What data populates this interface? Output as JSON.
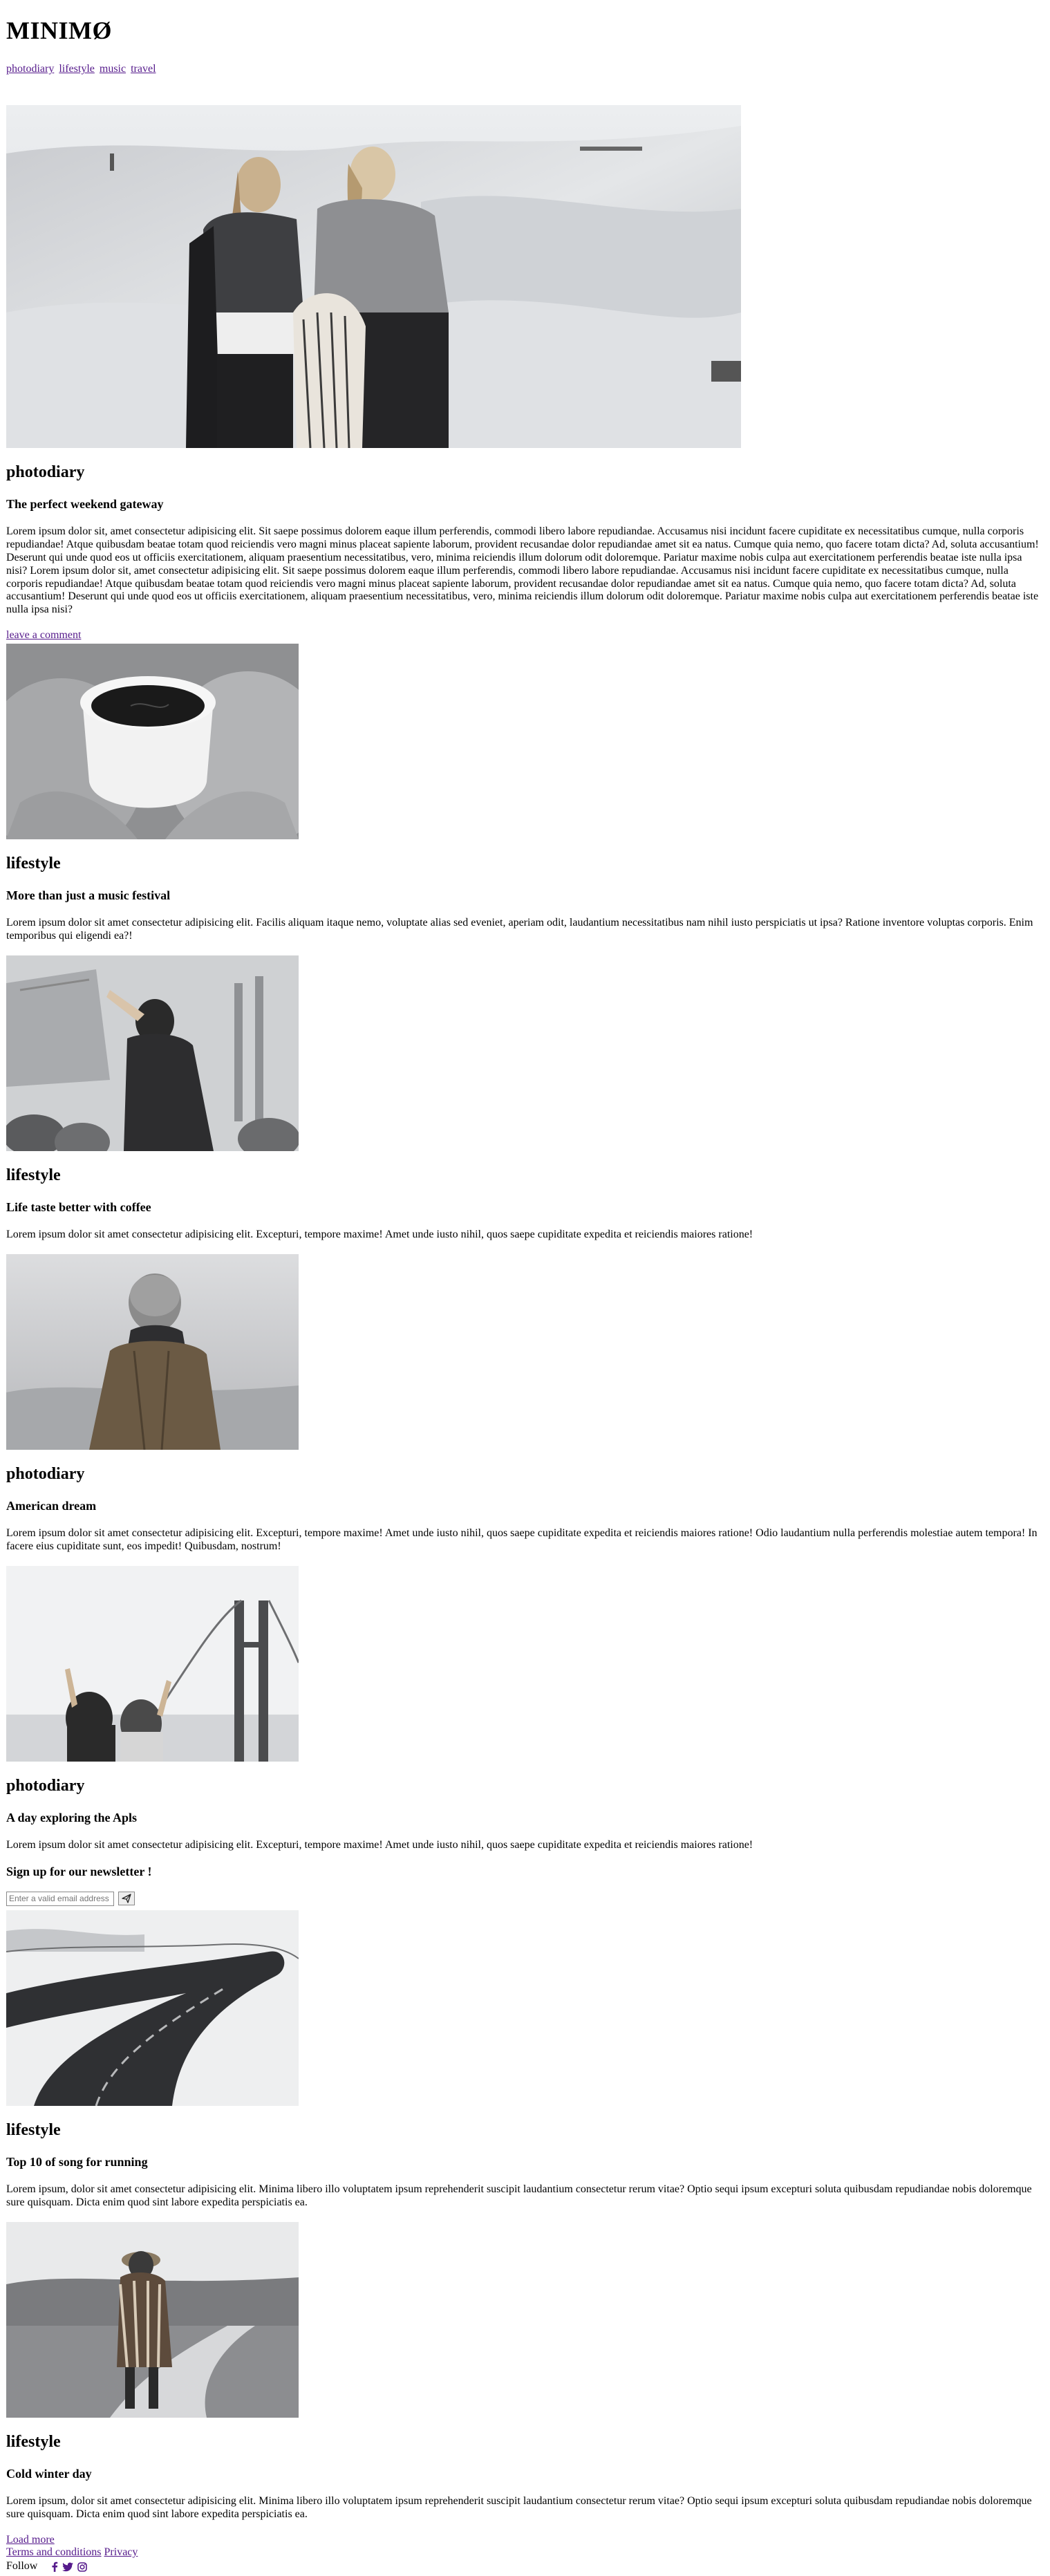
{
  "brand": "MINIMØ",
  "nav": [
    "photodiary",
    "lifestyle",
    "music",
    "travel"
  ],
  "hero": {
    "image_alt": "two women in winter clothing on snowy hill",
    "category": "photodiary",
    "title": "The perfect weekend gateway",
    "excerpt": "Lorem ipsum dolor sit, amet consectetur adipisicing elit. Sit saepe possimus dolorem eaque illum perferendis, commodi libero labore repudiandae. Accusamus nisi incidunt facere cupiditate ex necessitatibus cumque, nulla corporis repudiandae! Atque quibusdam beatae totam quod reiciendis vero magni minus placeat sapiente laborum, provident recusandae dolor repudiandae amet sit ea natus. Cumque quia nemo, quo facere totam dicta? Ad, soluta accusantium! Deserunt qui unde quod eos ut officiis exercitationem, aliquam praesentium necessitatibus, vero, minima reiciendis illum dolorum odit doloremque. Pariatur maxime nobis culpa aut exercitationem perferendis beatae iste nulla ipsa nisi? Lorem ipsum dolor sit, amet consectetur adipisicing elit. Sit saepe possimus dolorem eaque illum perferendis, commodi libero labore repudiandae. Accusamus nisi incidunt facere cupiditate ex necessitatibus cumque, nulla corporis repudiandae! Atque quibusdam beatae totam quod reiciendis vero magni minus placeat sapiente laborum, provident recusandae dolor repudiandae amet sit ea natus. Cumque quia nemo, quo facere totam dicta? Ad, soluta accusantium! Deserunt qui unde quod eos ut officiis exercitationem, aliquam praesentium necessitatibus, vero, minima reiciendis illum dolorum odit doloremque. Pariatur maxime nobis culpa aut exercitationem perferendis beatae iste nulla ipsa nisi?",
    "comment_link": "leave a comment"
  },
  "posts": [
    {
      "image_alt": "hands in knit mittens holding coffee cup",
      "category": "lifestyle",
      "title": "More than just a music festival",
      "excerpt": "Lorem ipsum dolor sit amet consectetur adipisicing elit. Facilis aliquam itaque nemo, voluptate alias sed eveniet, aperiam odit, laudantium necessitatibus nam nihil iusto perspiciatis ut ipsa? Ratione inventore voluptas corporis. Enim temporibus qui eligendi ea?!"
    },
    {
      "image_alt": "woman dancing at outdoor music festival",
      "category": "lifestyle",
      "title": "Life taste better with coffee",
      "excerpt": "Lorem ipsum dolor sit amet consectetur adipisicing elit. Excepturi, tempore maxime! Amet unde iusto nihil, quos saepe cupiditate expedita et reiciendis maiores ratione!"
    },
    {
      "image_alt": "person in beanie and jacket seen from behind",
      "category": "photodiary",
      "title": "American dream",
      "excerpt": "Lorem ipsum dolor sit amet consectetur adipisicing elit. Excepturi, tempore maxime! Amet unde iusto nihil, quos saepe cupiditate expedita et reiciendis maiores ratione! Odio laudantium nulla perferendis molestiae autem tempora! In facere eius cupiditate sunt, eos impedit! Quibusdam, nostrum!"
    },
    {
      "image_alt": "two friends with peace signs near bridge",
      "category": "photodiary",
      "title": "A day exploring the Apls",
      "excerpt": "Lorem ipsum dolor sit amet consectetur adipisicing elit. Excepturi, tempore maxime! Amet unde iusto nihil, quos saepe cupiditate expedita et reiciendis maiores ratione!"
    }
  ],
  "newsletter": {
    "title": "Sign up for our newsletter !",
    "placeholder": "Enter a valid email address"
  },
  "posts2": [
    {
      "image_alt": "winding road through snowy landscape",
      "category": "lifestyle",
      "title": "Top 10 of song for running",
      "excerpt": "Lorem ipsum, dolor sit amet consectetur adipisicing elit. Minima libero illo voluptatem ipsum reprehenderit suscipit laudantium consectetur rerum vitae? Optio sequi ipsum excepturi soluta quibusdam repudiandae nobis doloremque sure quisquam. Dicta enim quod sint labore expedita perspiciatis ea."
    },
    {
      "image_alt": "person in hat and shawl walking on dirt road",
      "category": "lifestyle",
      "title": "Cold winter day",
      "excerpt": "Lorem ipsum, dolor sit amet consectetur adipisicing elit. Minima libero illo voluptatem ipsum reprehenderit suscipit laudantium consectetur rerum vitae? Optio sequi ipsum excepturi soluta quibusdam repudiandae nobis doloremque sure quisquam. Dicta enim quod sint labore expedita perspiciatis ea."
    }
  ],
  "footer": {
    "load_more": "Load more",
    "terms": "Terms and conditions",
    "privacy": "Privacy",
    "follow_label": "Follow",
    "social_icons": [
      "facebook-icon",
      "twitter-icon",
      "instagram-icon"
    ]
  }
}
